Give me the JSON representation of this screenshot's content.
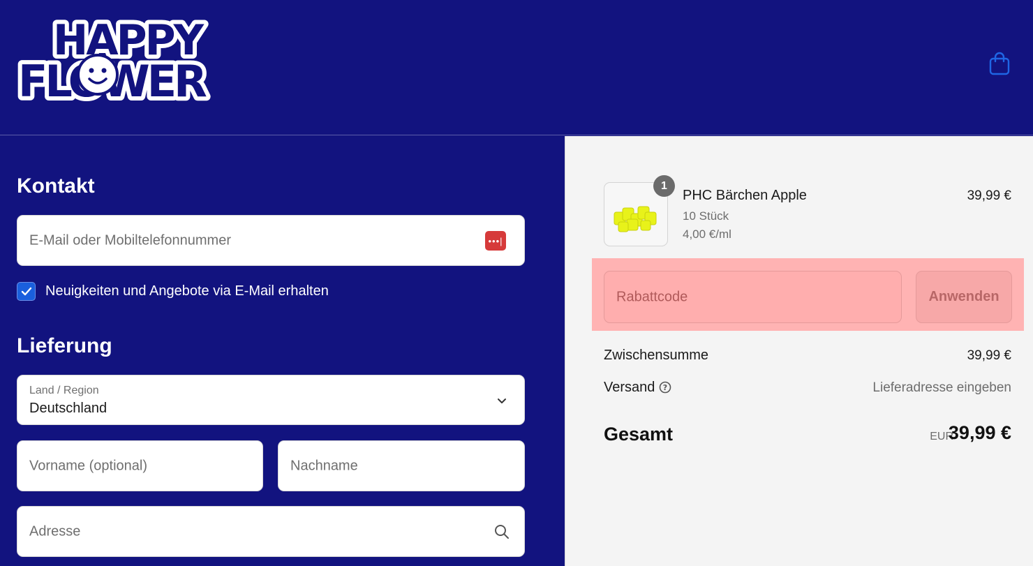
{
  "brand": {
    "logo_text_line1": "HAPPY",
    "logo_text_line2": "FLOWER"
  },
  "header": {
    "cart_icon": "shopping-bag-icon"
  },
  "contact": {
    "title": "Kontakt",
    "email_placeholder": "E-Mail oder Mobiltelefonnummer",
    "newsletter_label": "Neuigkeiten und Angebote via E-Mail erhalten",
    "newsletter_checked": true
  },
  "delivery": {
    "title": "Lieferung",
    "country_label": "Land / Region",
    "country_value": "Deutschland",
    "first_name_placeholder": "Vorname (optional)",
    "last_name_placeholder": "Nachname",
    "address_placeholder": "Adresse"
  },
  "order": {
    "item": {
      "quantity": "1",
      "name": "PHC Bärchen Apple",
      "variant": "10 Stück",
      "unit_price": "4,00 €/ml",
      "price": "39,99 €"
    },
    "discount_placeholder": "Rabattcode",
    "apply_label": "Anwenden",
    "subtotal_label": "Zwischensumme",
    "subtotal_value": "39,99 €",
    "shipping_label": "Versand",
    "shipping_value": "Lieferadresse eingeben",
    "total_label": "Gesamt",
    "currency": "EUR",
    "total_value": "39,99 €"
  },
  "colors": {
    "brand_navy": "#12137f",
    "checkbox_blue": "#1a5fdd",
    "highlight": "#ffb3b3"
  }
}
